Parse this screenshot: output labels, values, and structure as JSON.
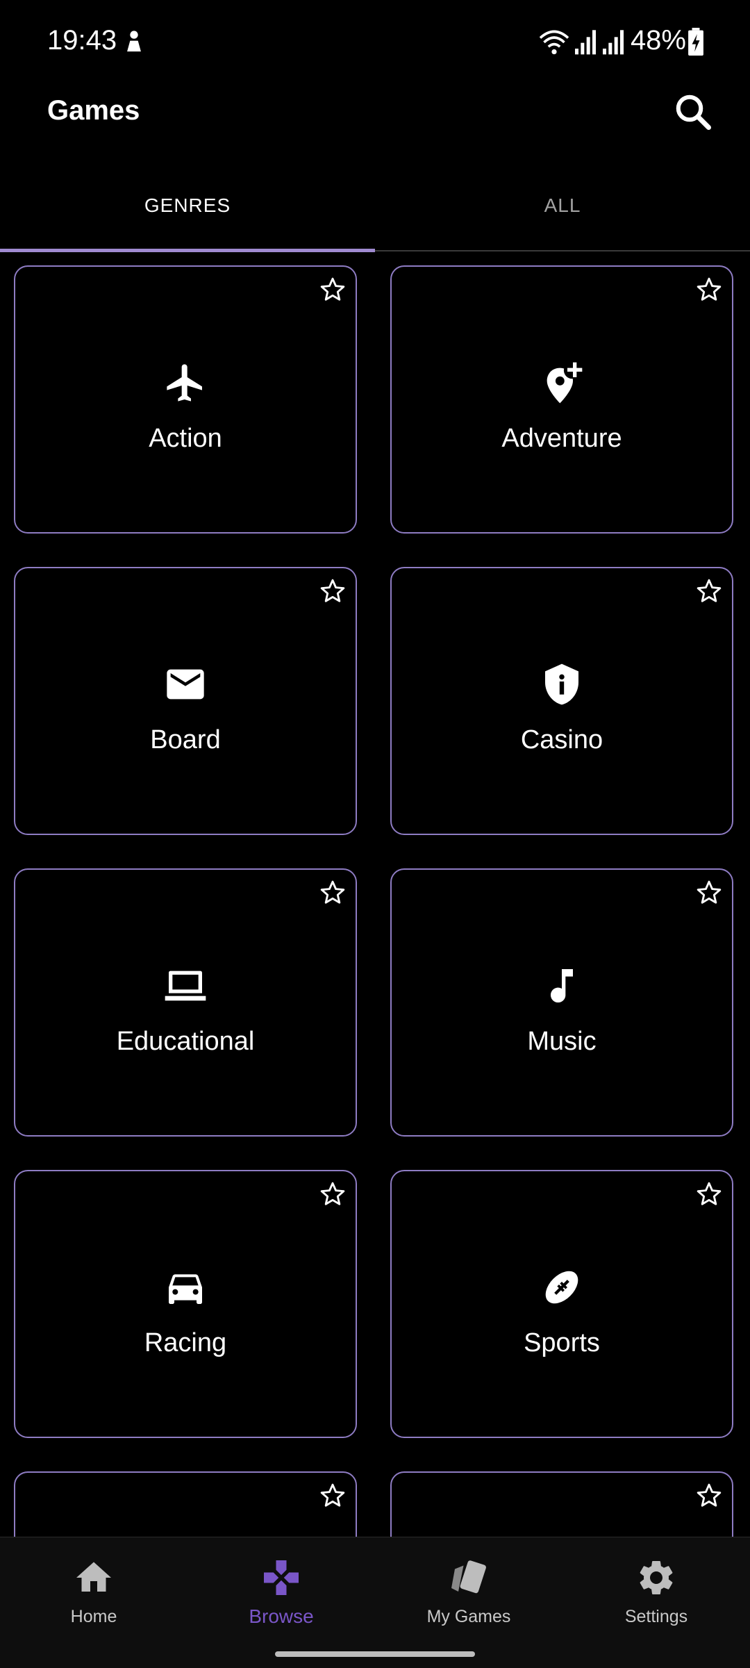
{
  "status": {
    "time": "19:43",
    "battery": "48%"
  },
  "appbar": {
    "title": "Games"
  },
  "tabs": [
    {
      "label": "GENRES"
    },
    {
      "label": "ALL"
    }
  ],
  "genres": [
    {
      "label": "Action",
      "icon": "airplane-icon"
    },
    {
      "label": "Adventure",
      "icon": "location-add-icon"
    },
    {
      "label": "Board",
      "icon": "envelope-icon"
    },
    {
      "label": "Casino",
      "icon": "shield-info-icon"
    },
    {
      "label": "Educational",
      "icon": "laptop-icon"
    },
    {
      "label": "Music",
      "icon": "music-note-icon"
    },
    {
      "label": "Racing",
      "icon": "car-icon"
    },
    {
      "label": "Sports",
      "icon": "football-icon"
    }
  ],
  "bottom_nav": [
    {
      "label": "Home"
    },
    {
      "label": "Browse"
    },
    {
      "label": "My Games"
    },
    {
      "label": "Settings"
    }
  ],
  "colors": {
    "accent": "#9f8ad0",
    "browse_active": "#7a56c8",
    "card_border": "#8e7cc3"
  }
}
